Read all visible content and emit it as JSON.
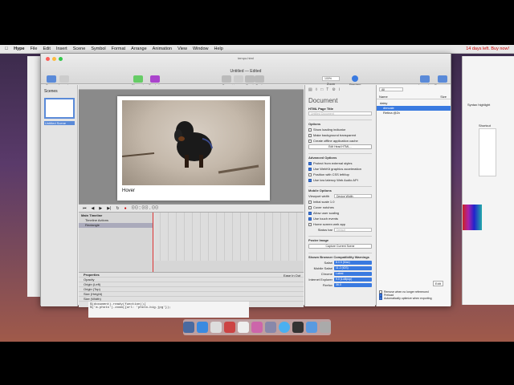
{
  "menubar": {
    "app": "Hype",
    "items": [
      "File",
      "Edit",
      "Insert",
      "Scene",
      "Symbol",
      "Format",
      "Arrange",
      "Animation",
      "View",
      "Window",
      "Help"
    ],
    "status": "14 days left. Buy now!"
  },
  "browser_tab": "tempo.html",
  "window": {
    "title": "Untitled — Edited",
    "toolbar": {
      "scenes": "Scenes",
      "layouts": "Layouts",
      "elements": "Elements",
      "symbols": "Symbols",
      "group": "Group",
      "ungroup": "Ungroup",
      "front": "Front",
      "back": "Back",
      "zoom_value": "100%",
      "zoom": "Zoom",
      "preview": "Preview",
      "inspector": "Inspector",
      "resources": "Resources"
    },
    "sidebar": {
      "header": "Scenes",
      "scene_name": "Untitled Scene"
    },
    "canvas": {
      "label": "Hover"
    },
    "timeline": {
      "time": "00:00.00",
      "main_timeline": "Main Timeline",
      "timeline_actions": "Timeline Actions",
      "layer": "Rectangle",
      "properties_header": "Properties",
      "properties": [
        "Opacity",
        "Origin (Left)",
        "Origin (Top)",
        "Size (Height)",
        "Size (Width)"
      ],
      "ease": "Ease In Out"
    },
    "inspector": {
      "title": "Document",
      "html_page_title_label": "HTML Page Title",
      "html_page_title_placeholder": "Untitled Document",
      "options_header": "Options",
      "options": [
        {
          "label": "Show loading indicator",
          "checked": false
        },
        {
          "label": "Make background transparent",
          "checked": false
        },
        {
          "label": "Create offline application cache",
          "checked": false
        }
      ],
      "edit_head": "Edit Head HTML...",
      "advanced_header": "Advanced Options",
      "advanced": [
        {
          "label": "Protect from external styles",
          "checked": true
        },
        {
          "label": "Use WebKit graphics acceleration",
          "checked": true
        },
        {
          "label": "Position with CSS left/top",
          "checked": false
        },
        {
          "label": "Use low latency Web Audio API",
          "checked": true
        }
      ],
      "mobile_header": "Mobile Options",
      "viewport_label": "Viewport width",
      "viewport_value": "Device Width",
      "mobile": [
        {
          "label": "Initial scale 1.0",
          "checked": false
        },
        {
          "label": "Cover notches",
          "checked": false
        },
        {
          "label": "Allow user scaling",
          "checked": true
        },
        {
          "label": "Use touch events",
          "checked": true
        },
        {
          "label": "Home screen web app",
          "checked": false
        }
      ],
      "status_bar_label": "Status bar",
      "status_bar_value": "Default",
      "poster_header": "Poster Image",
      "capture_btn": "Capture Current Scene",
      "compat_header": "Shown Browser Compatibility Warnings",
      "compat": [
        {
          "label": "Safari",
          "value": "8.0.5 (Mac)"
        },
        {
          "label": "Mobile Safari",
          "value": "11.2 (iOS)"
        },
        {
          "label": "Chrome",
          "value": "Latest"
        },
        {
          "label": "Internet Explorer",
          "value": "9.0 (Lollipop)"
        },
        {
          "label": "Firefox",
          "value": "36.0"
        }
      ]
    },
    "resources": {
      "filter": "All",
      "col_name": "Name",
      "col_size": "Size",
      "items": [
        {
          "name": "daisy",
          "selected": false
        },
        {
          "name": "dimcale",
          "selected": true
        },
        {
          "name": "Retina @2x",
          "selected": false
        }
      ],
      "edit": "Edit",
      "checks": [
        {
          "label": "Remove when no longer referenced",
          "checked": false
        },
        {
          "label": "Preload",
          "checked": true
        },
        {
          "label": "Automatically optimize when exporting",
          "checked": true
        }
      ]
    }
  },
  "backwin": {
    "label": "Syntax highlight",
    "shortcut": "Shortcut"
  },
  "code": {
    "line1": "$(document).ready(function(){",
    "line2": "  $('a.photo').zoom({url: 'photo-big.jpg'});"
  },
  "colors": {
    "accent": "#3a7ae0",
    "selection": "#5a8ad8",
    "alert": "#cc0000"
  }
}
